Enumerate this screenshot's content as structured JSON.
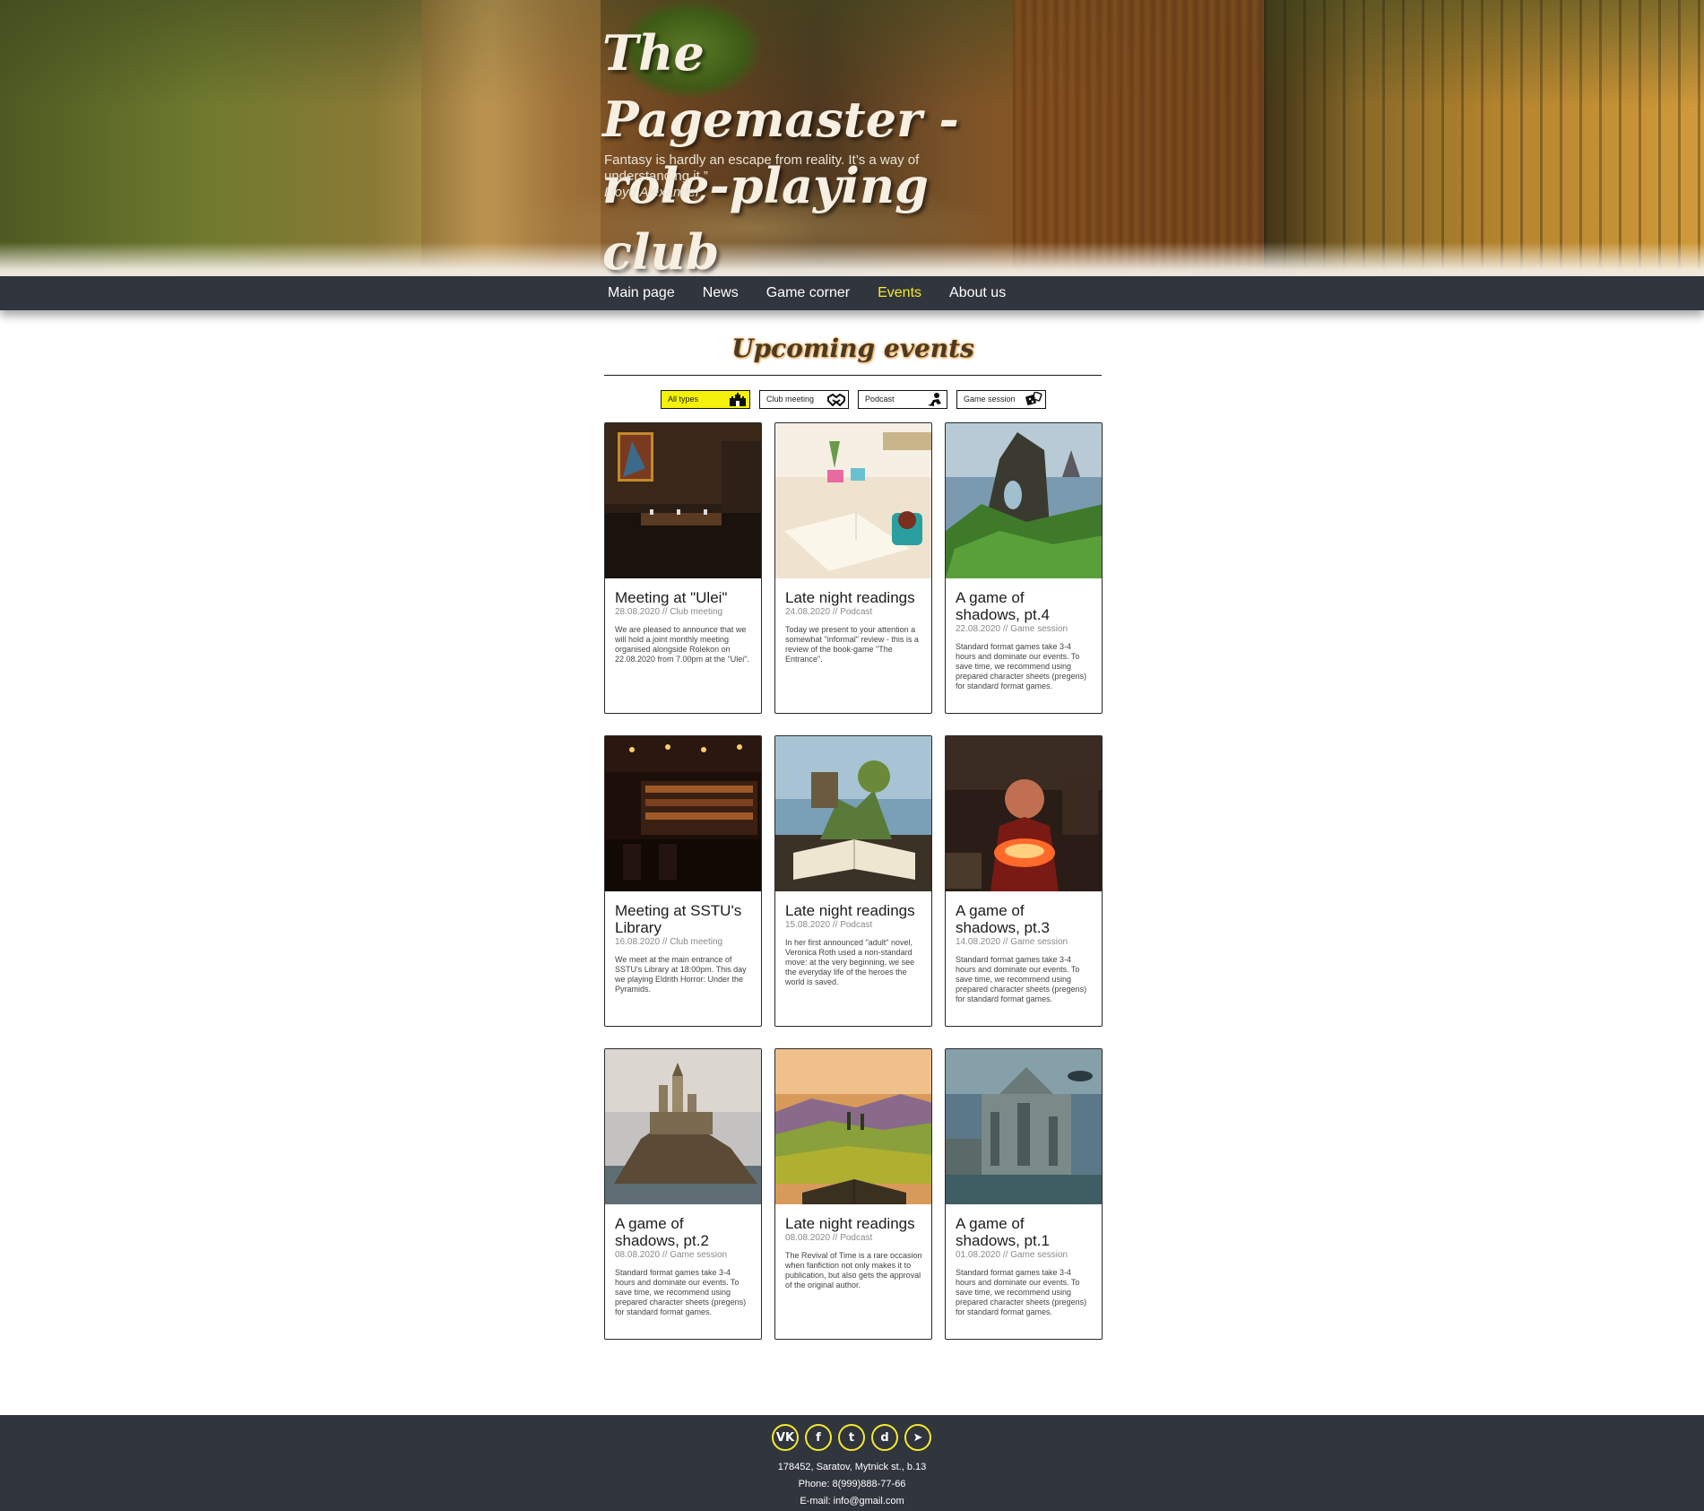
{
  "hero": {
    "title_line1": "The Pagemaster -",
    "title_line2": "role-playing club",
    "quote_line1": "Fantasy is hardly an escape from reality. It’s a way of",
    "quote_line2": "understanding it.”",
    "quote_author": "Lloyd Alexander"
  },
  "nav": {
    "items": [
      {
        "label": "Main page"
      },
      {
        "label": "News"
      },
      {
        "label": "Game corner"
      },
      {
        "label": "Events",
        "active": true
      },
      {
        "label": "About us"
      }
    ],
    "active_color": "#f4ea2a"
  },
  "events": {
    "title": "Upcoming events",
    "filters": [
      {
        "label": "All types",
        "icon": "castle-icon",
        "active": true
      },
      {
        "label": "Club meeting",
        "icon": "handshake-icon"
      },
      {
        "label": "Podcast",
        "icon": "reading-icon"
      },
      {
        "label": "Game session",
        "icon": "dice-icon"
      }
    ],
    "cards": [
      {
        "title": "Meeting at \"Ulei\"",
        "date": "28.08.2020",
        "type": "Club meeting",
        "desc": "We are pleased to announce that we will hold a joint monthly meeting organised alongside Rolekon on 22.08.2020 from 7.00pm at the \"Ulei\".",
        "image": "restaurant-image"
      },
      {
        "title": "Late night readings",
        "date": "24.08.2020",
        "type": "Podcast",
        "desc": "Today we present to your attention a somewhat \"informal\" review - this is a review of the book-game \"The Entrance\".",
        "image": "book-and-tea-image"
      },
      {
        "title": "A game of shadows, pt.4",
        "date": "22.08.2020",
        "type": "Game session",
        "desc": "Standard format games take 3-4 hours and dominate our events. To save time, we recommend using prepared character sheets (pregens) for standard format games.",
        "image": "fantasy-cliffs-image"
      },
      {
        "title": "Meeting at SSTU's Library",
        "date": "16.08.2020",
        "type": "Club meeting",
        "desc": "We meet at the main entrance of SSTU's Library at 18:00pm. This day we playing Eldrith Horror: Under the Pyramids.",
        "image": "bar-interior-image"
      },
      {
        "title": "Late night readings",
        "date": "15.08.2020",
        "type": "Podcast",
        "desc": "In her first announced \"adult\" novel, Veronica Roth used a non-standard move: at the very beginning, we see the everyday life of the heroes the world is saved.",
        "image": "open-book-world-image"
      },
      {
        "title": "A game of shadows, pt.3",
        "date": "14.08.2020",
        "type": "Game session",
        "desc": "Standard format games take 3-4 hours and dominate our events. To save time, we recommend using prepared character sheets (pregens) for standard format games.",
        "image": "wizard-cauldron-image"
      },
      {
        "title": "A game of shadows, pt.2",
        "date": "08.08.2020",
        "type": "Game session",
        "desc": "Standard format games take 3-4 hours and dominate our events. To save time, we recommend using prepared character sheets (pregens) for standard format games.",
        "image": "island-castle-image"
      },
      {
        "title": "Late night readings",
        "date": "08.08.2020",
        "type": "Podcast",
        "desc": "The Revival of Time is a rare occasion when fanfiction not only makes it to publication, but also gets the approval of the original author.",
        "image": "book-landscape-image"
      },
      {
        "title": "A game of shadows, pt.1",
        "date": "01.08.2020",
        "type": "Game session",
        "desc": "Standard format games take 3-4 hours and dominate our events. To save time, we recommend using prepared character sheets (pregens) for standard format games.",
        "image": "steampunk-city-image"
      }
    ]
  },
  "footer": {
    "socials": [
      {
        "name": "vk-icon",
        "glyph": "VK"
      },
      {
        "name": "facebook-icon",
        "glyph": "f"
      },
      {
        "name": "twitter-icon",
        "glyph": "t"
      },
      {
        "name": "discord-icon",
        "glyph": "d"
      },
      {
        "name": "telegram-icon",
        "glyph": "➤"
      }
    ],
    "address": "178452, Saratov, Mytnick st., b.13",
    "phone": "Phone: 8(999)888-77-66",
    "email": "E-mail: info@gmail.com"
  }
}
